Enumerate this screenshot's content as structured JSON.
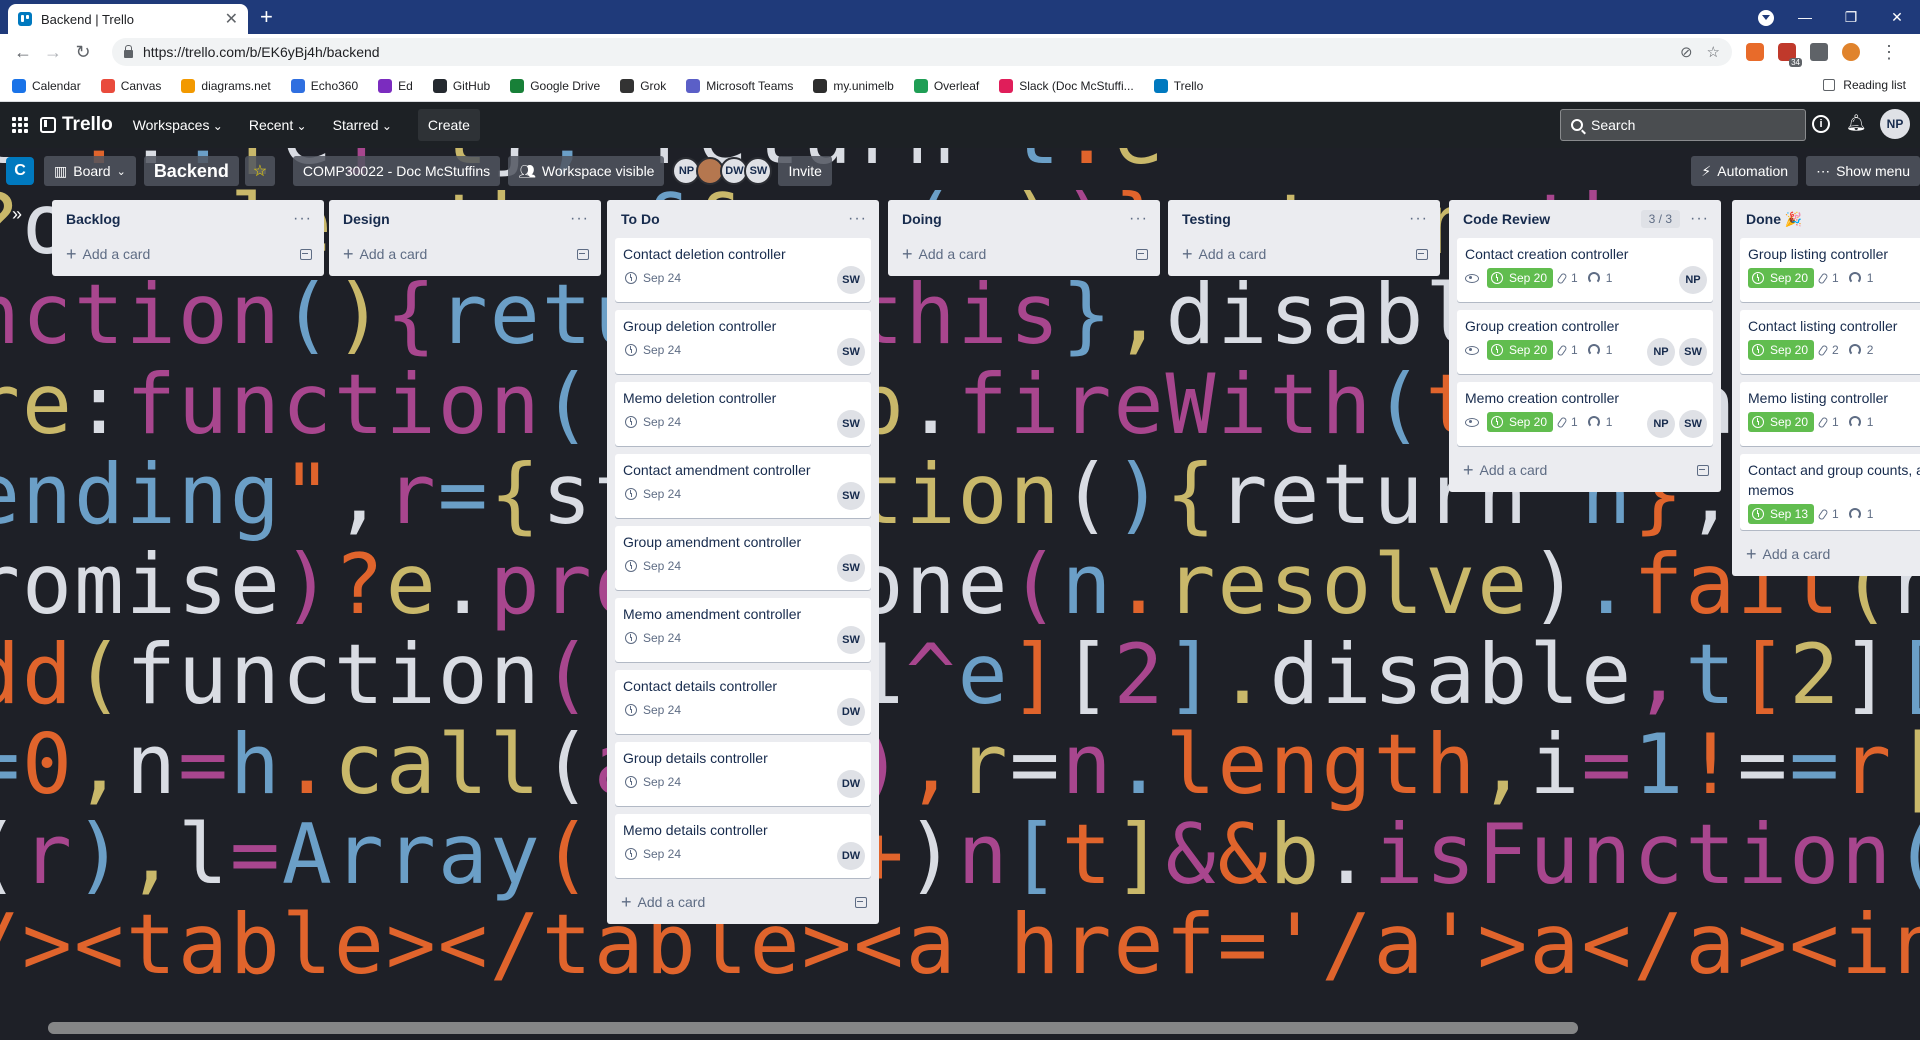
{
  "browser": {
    "tab_title": "Backend | Trello",
    "url": "https://trello.com/b/EK6yBj4h/backend",
    "ext_badge": "34",
    "bookmarks": [
      "Calendar",
      "Canvas",
      "diagrams.net",
      "Echo360",
      "Ed",
      "GitHub",
      "Google Drive",
      "Grok",
      "Microsoft Teams",
      "my.unimelb",
      "Overleaf",
      "Slack (Doc McStuffi...",
      "Trello"
    ],
    "reading_list": "Reading list"
  },
  "header": {
    "logo": "Trello",
    "nav": [
      "Workspaces",
      "Recent",
      "Starred"
    ],
    "create": "Create",
    "search_placeholder": "Search",
    "user_initials": "NP"
  },
  "board": {
    "workspace_initial": "C",
    "view": "Board",
    "title": "Backend",
    "workspace_name": "COMP30022 - Doc McStuffins",
    "visibility": "Workspace visible",
    "members": [
      "NP",
      "",
      "DW",
      "SW"
    ],
    "invite": "Invite",
    "automation": "Automation",
    "show_menu": "Show menu"
  },
  "lists": [
    {
      "title": "Backlog",
      "count": "",
      "add": "Add a card",
      "cards": []
    },
    {
      "title": "Design",
      "count": "",
      "add": "Add a card",
      "cards": []
    },
    {
      "title": "To Do",
      "count": "",
      "add": "Add a card",
      "cards": [
        {
          "title": "Contact deletion controller",
          "due": "Sep 24",
          "members": [
            "SW"
          ]
        },
        {
          "title": "Group deletion controller",
          "due": "Sep 24",
          "members": [
            "SW"
          ]
        },
        {
          "title": "Memo deletion controller",
          "due": "Sep 24",
          "members": [
            "SW"
          ]
        },
        {
          "title": "Contact amendment controller",
          "due": "Sep 24",
          "members": [
            "SW"
          ]
        },
        {
          "title": "Group amendment controller",
          "due": "Sep 24",
          "members": [
            "SW"
          ]
        },
        {
          "title": "Memo amendment controller",
          "due": "Sep 24",
          "members": [
            "SW"
          ]
        },
        {
          "title": "Contact details controller",
          "due": "Sep 24",
          "members": [
            "DW"
          ]
        },
        {
          "title": "Group details controller",
          "due": "Sep 24",
          "members": [
            "DW"
          ]
        },
        {
          "title": "Memo details controller",
          "due": "Sep 24",
          "members": [
            "DW"
          ]
        }
      ]
    },
    {
      "title": "Doing",
      "count": "",
      "add": "Add a card",
      "cards": []
    },
    {
      "title": "Testing",
      "count": "",
      "add": "Add a card",
      "cards": []
    },
    {
      "title": "Code Review",
      "count": "3 / 3",
      "add": "Add a card",
      "cards": [
        {
          "title": "Contact creation controller",
          "watch": true,
          "due": "Sep 20",
          "complete": true,
          "attachments": "1",
          "github": "1",
          "members": [
            "NP"
          ]
        },
        {
          "title": "Group creation controller",
          "watch": true,
          "due": "Sep 20",
          "complete": true,
          "attachments": "1",
          "github": "1",
          "members": [
            "NP",
            "SW"
          ]
        },
        {
          "title": "Memo creation controller",
          "watch": true,
          "due": "Sep 20",
          "complete": true,
          "attachments": "1",
          "github": "1",
          "members": [
            "NP",
            "SW"
          ]
        }
      ]
    },
    {
      "title": "Done 🎉",
      "count": "",
      "add": "Add a card",
      "cards": [
        {
          "title": "Group listing controller",
          "due": "Sep 20",
          "complete": true,
          "attachments": "1",
          "github": "1",
          "members": []
        },
        {
          "title": "Contact listing controller",
          "due": "Sep 20",
          "complete": true,
          "attachments": "2",
          "github": "2",
          "members": []
        },
        {
          "title": "Memo listing controller",
          "due": "Sep 20",
          "complete": true,
          "attachments": "1",
          "github": "1",
          "members": []
        },
        {
          "title": "Contact and group counts, and memos",
          "due": "Sep 13",
          "complete": true,
          "attachments": "1",
          "github": "1",
          "members": []
        }
      ]
    }
  ],
  "background_code": [
    "t-...[e]-t}, return t.e",
    "?o=u.length:r&&   (r))}return th",
    "nction(){return  this},disable",
    "re:function(){re p.fireWith(this,arg",
    "ending\",r={stat  tion(){return n},alwa",
    "romise)?e.promi  one(n.resolve).fail(n.re",
    "dd(function(){r  1^e][2].disable,t[2][2].",
    "=0,n=h.call(arg  ),r=n.length,i=1!==r||e&",
    "(r),l=Array(r);  +)n[t]&&b.isFunction(n[t",
    "/><table></table><a href='/a'>a</a><input type"
  ]
}
